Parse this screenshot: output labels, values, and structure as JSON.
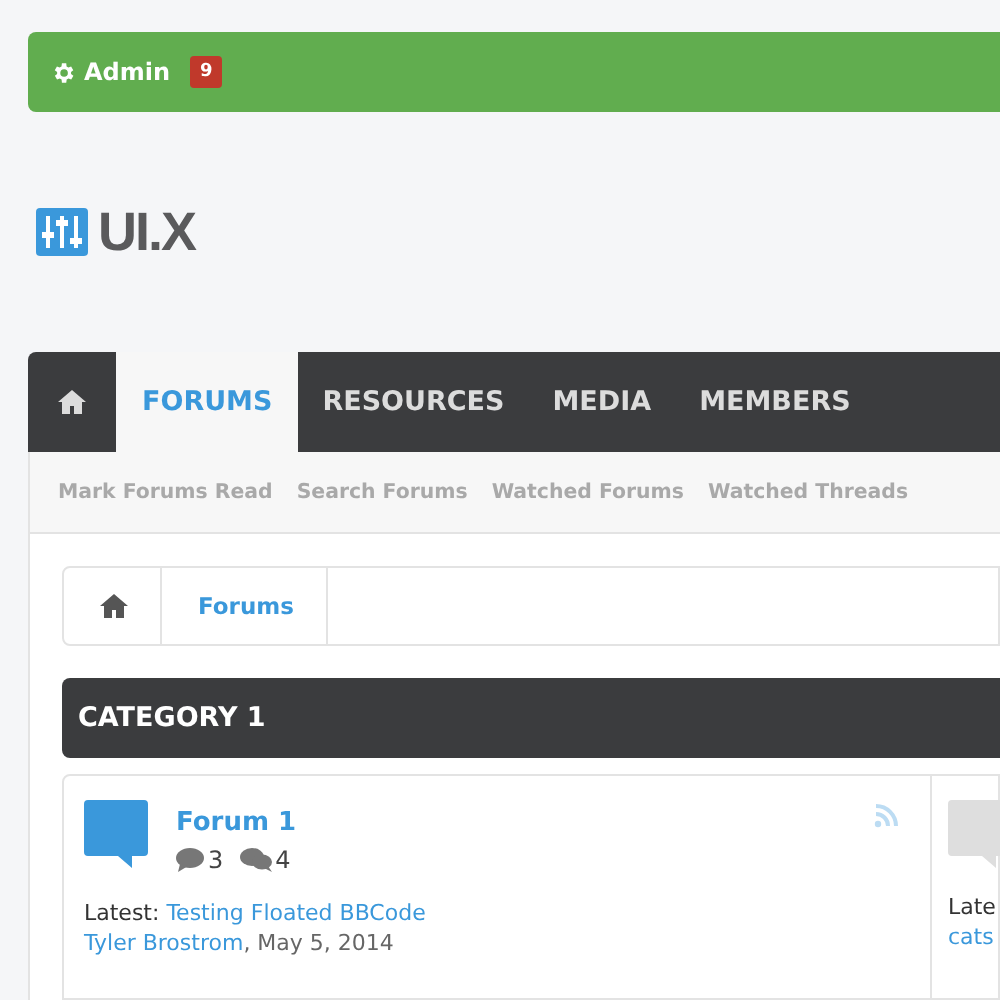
{
  "user_bar": {
    "username": "Admin",
    "alerts": "9"
  },
  "logo": {
    "text": "UI.X"
  },
  "nav": {
    "tabs": [
      {
        "kind": "home",
        "selected": false
      },
      {
        "label": "FORUMS",
        "selected": true
      },
      {
        "label": "RESOURCES",
        "selected": false
      },
      {
        "label": "MEDIA",
        "selected": false
      },
      {
        "label": "MEMBERS",
        "selected": false
      }
    ],
    "sub_links": [
      "Mark Forums Read",
      "Search Forums",
      "Watched Forums",
      "Watched Threads"
    ]
  },
  "breadcrumb": [
    {
      "kind": "home"
    },
    {
      "label": "Forums"
    }
  ],
  "category": {
    "title": "CATEGORY 1",
    "forums": [
      {
        "title": "Forum 1",
        "unread": true,
        "discussions": "3",
        "messages": "4",
        "latest_label": "Latest:",
        "latest_thread": "Testing Floated BBCode",
        "latest_user": "Tyler Brostrom",
        "latest_date": ", May 5, 2014"
      },
      {
        "unread": false,
        "latest_label": "Late",
        "latest_user": "cats"
      }
    ]
  }
}
